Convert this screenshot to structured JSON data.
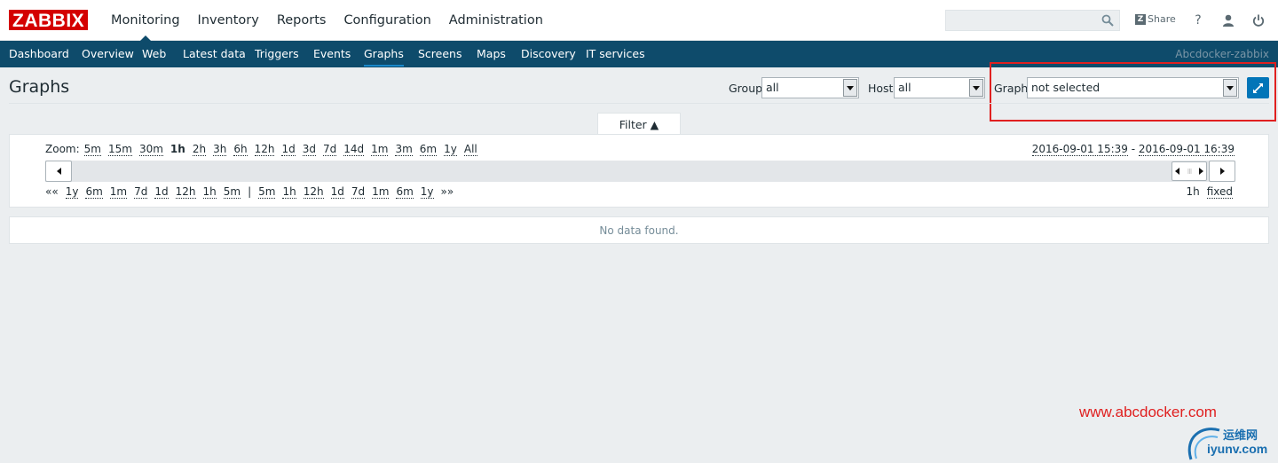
{
  "logo": "ZABBIX",
  "main_nav": [
    {
      "label": "Monitoring",
      "active": true
    },
    {
      "label": "Inventory"
    },
    {
      "label": "Reports"
    },
    {
      "label": "Configuration"
    },
    {
      "label": "Administration"
    }
  ],
  "header": {
    "search_value": "",
    "share_label": "Share",
    "help_label": "?"
  },
  "sub_nav": [
    {
      "label": "Dashboard"
    },
    {
      "label": "Overview"
    },
    {
      "label": "Web"
    },
    {
      "label": "Latest data"
    },
    {
      "label": "Triggers"
    },
    {
      "label": "Events"
    },
    {
      "label": "Graphs",
      "active": true
    },
    {
      "label": "Screens"
    },
    {
      "label": "Maps"
    },
    {
      "label": "Discovery"
    },
    {
      "label": "IT services"
    }
  ],
  "server_name": "Abcdocker-zabbix",
  "page": {
    "title": "Graphs",
    "group_label": "Group",
    "group_value": "all",
    "host_label": "Host",
    "host_value": "all",
    "graph_label": "Graph",
    "graph_value": "not selected"
  },
  "filter": {
    "tab_label": "Filter ▲",
    "zoom_label": "Zoom:",
    "zoom_options": [
      "5m",
      "15m",
      "30m",
      "1h",
      "2h",
      "3h",
      "6h",
      "12h",
      "1d",
      "3d",
      "7d",
      "14d",
      "1m",
      "3m",
      "6m",
      "1y",
      "All"
    ],
    "zoom_selected": "1h",
    "period_from": "2016-09-01 15:39",
    "period_sep": " - ",
    "period_to": "2016-09-01 16:39",
    "nav_back_label": "««",
    "nav_back": [
      "1y",
      "6m",
      "1m",
      "7d",
      "1d",
      "12h",
      "1h",
      "5m"
    ],
    "nav_divider": "|",
    "nav_forward": [
      "5m",
      "1h",
      "12h",
      "1d",
      "7d",
      "1m",
      "6m",
      "1y"
    ],
    "nav_forward_label": "»»",
    "period_length": "1h",
    "period_mode": "fixed"
  },
  "message": "No data found.",
  "watermark": {
    "site": "www.abcdocker.com",
    "logo_cn": "运维网",
    "logo_en": "iyunv.com"
  },
  "colors": {
    "brand_red": "#d40000",
    "subnav_bg": "#0e4b6b",
    "accent_blue": "#0275b8",
    "annotation_red": "#e02020"
  }
}
